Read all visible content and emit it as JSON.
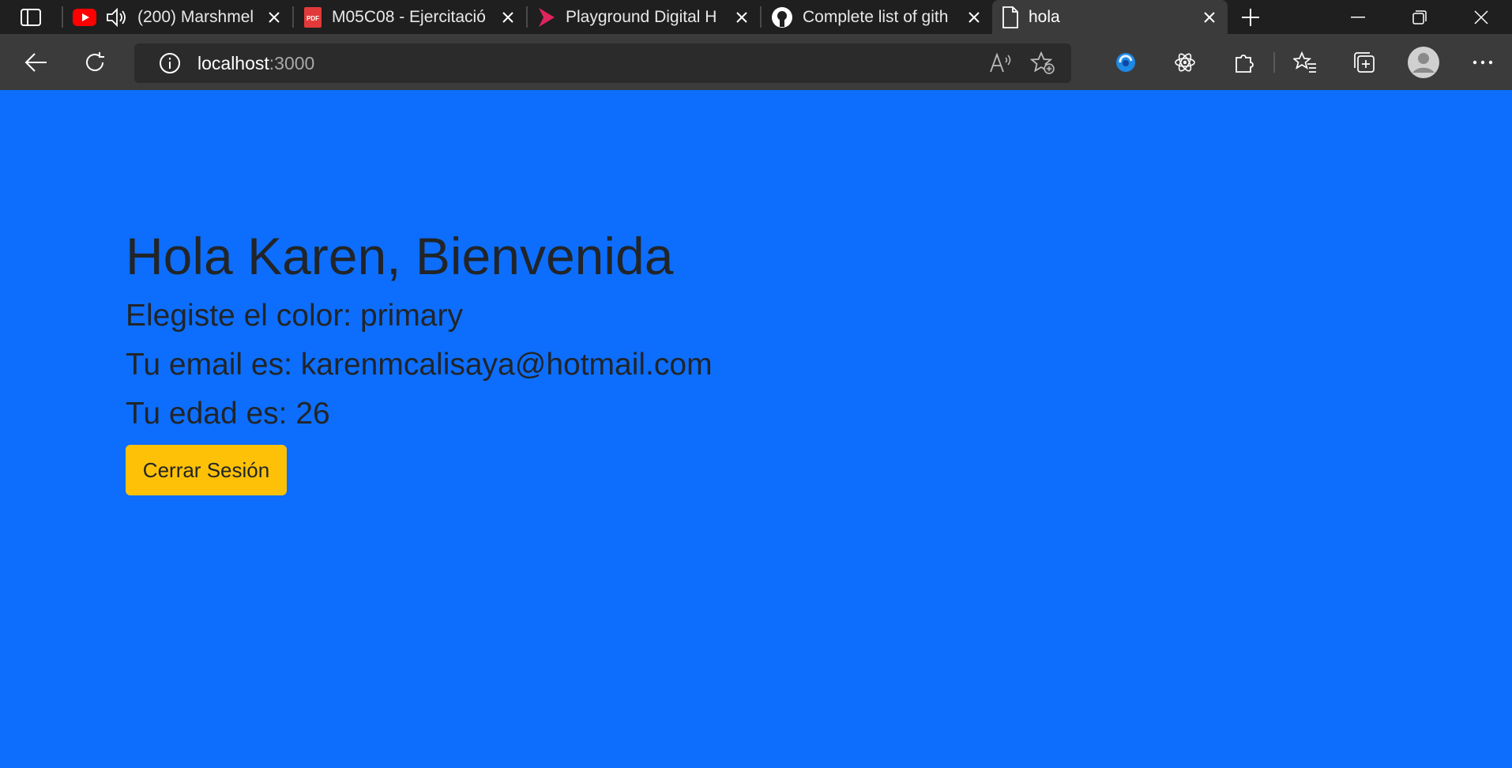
{
  "tabs": [
    {
      "title": "(200) Marshmel",
      "icon": "youtube-icon",
      "audio": true
    },
    {
      "title": "M05C08 - Ejercitació",
      "icon": "pdf-icon"
    },
    {
      "title": "Playground Digital H",
      "icon": "digital-house-icon"
    },
    {
      "title": "Complete list of gith",
      "icon": "github-icon"
    },
    {
      "title": "hola",
      "icon": "page-icon",
      "active": true
    }
  ],
  "address": {
    "host": "localhost",
    "port": ":3000"
  },
  "page": {
    "greeting": "Hola Karen, Bienvenida",
    "color_line": "Elegiste el color: primary",
    "email_line": "Tu email es: karenmcalisaya@hotmail.com",
    "age_line": "Tu edad es: 26",
    "logout_label": "Cerrar Sesión"
  },
  "colors": {
    "background": "#0d6efd",
    "button": "#ffc107",
    "text": "#212529"
  }
}
